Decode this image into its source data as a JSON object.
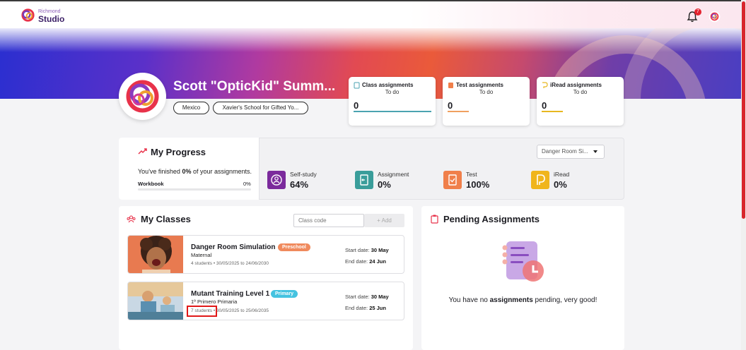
{
  "app": {
    "logo_small": "Richmond",
    "logo_big": "Studio",
    "notification_count": "7",
    "icons": [
      "bell-icon",
      "user-avatar-icon"
    ]
  },
  "profile": {
    "name": "Scott \"OpticKid\" Summ...",
    "country": "Mexico",
    "school": "Xavier's School for Gifted Yo..."
  },
  "assignment_cards": [
    {
      "title": "Class assignments",
      "subtitle": "To do",
      "value": "0",
      "color": "#4ba3b0"
    },
    {
      "title": "Test assignments",
      "subtitle": "To do",
      "value": "0",
      "color": "#f0a060"
    },
    {
      "title": "iRead assignments",
      "subtitle": "To do",
      "value": "0",
      "color": "#e8b820"
    }
  ],
  "progress": {
    "title": "My Progress",
    "finished_prefix": "You've finished ",
    "finished_value": "0%",
    "finished_suffix": " of your assignments.",
    "workbook_label": "Workbook",
    "workbook_value": "0%",
    "workbook_fraction": 0,
    "class_select": "Danger Room Si...",
    "stats": [
      {
        "label": "Self-study",
        "value": "64%",
        "color": "#7b2a9c",
        "icon": "self-study-icon"
      },
      {
        "label": "Assignment",
        "value": "0%",
        "color": "#3a9d9a",
        "icon": "assignment-icon"
      },
      {
        "label": "Test",
        "value": "100%",
        "color": "#f07f4a",
        "icon": "test-icon"
      },
      {
        "label": "iRead",
        "value": "0%",
        "color": "#f0b51c",
        "icon": "iread-icon"
      }
    ]
  },
  "classes": {
    "title": "My Classes",
    "code_placeholder": "Class code",
    "add_label": "+ Add",
    "items": [
      {
        "name": "Danger Room Simulation",
        "badge": "Preschool",
        "badge_color": "#f08a5d",
        "level": "Maternal",
        "students": "4 students",
        "dates": "• 30/05/2025 to 24/06/2030",
        "start_label": "Start date:",
        "start": "30 May",
        "end_label": "End date:",
        "end": "24 Jun"
      },
      {
        "name": "Mutant Training Level 1",
        "badge": "Primary",
        "badge_color": "#45c3e0",
        "level": "1º Primero Primaria",
        "students": "7 students",
        "dates": "• 30/05/2025 to 25/06/2035",
        "start_label": "Start date:",
        "start": "30 May",
        "end_label": "End date:",
        "end": "25 Jun"
      }
    ]
  },
  "pending": {
    "title": "Pending Assignments",
    "msg_prefix": "You have no ",
    "msg_bold": "assignments",
    "msg_suffix": " pending, very good!"
  }
}
